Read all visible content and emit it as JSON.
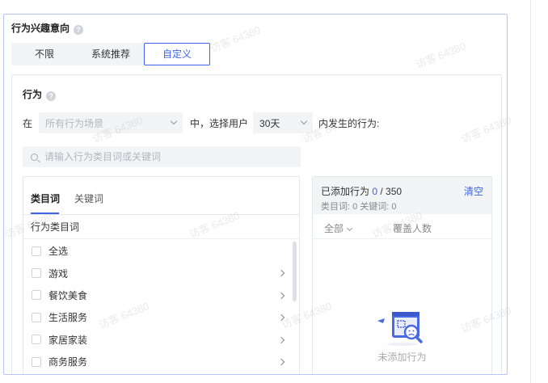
{
  "section": {
    "title": "行为兴趣意向"
  },
  "segment": {
    "options": [
      "不限",
      "系统推荐",
      "自定义"
    ],
    "selected": "自定义"
  },
  "behavior": {
    "title": "行为",
    "prefix_in": "在",
    "scene_placeholder": "所有行为场景",
    "mid_text": "中，选择用户",
    "days_value": "30天",
    "suffix_text": "内发生的行为:",
    "search_placeholder": "请输入行为类目词或关键词"
  },
  "left_panel": {
    "tabs": [
      "类目词",
      "关键词"
    ],
    "active_tab": "类目词",
    "list_header": "行为类目词",
    "items": [
      {
        "label": "全选",
        "has_children": false
      },
      {
        "label": "游戏",
        "has_children": true
      },
      {
        "label": "餐饮美食",
        "has_children": true
      },
      {
        "label": "生活服务",
        "has_children": true
      },
      {
        "label": "家居家装",
        "has_children": true
      },
      {
        "label": "商务服务",
        "has_children": true
      }
    ]
  },
  "right_panel": {
    "added_label": "已添加行为",
    "added_count": "0",
    "added_sep": " / 350",
    "clear_label": "清空",
    "counts_text": "类目词: 0   关键词: 0",
    "col_all": "全部",
    "col_cover": "覆盖人数",
    "empty_text": "未添加行为"
  },
  "watermark_text": "访客 64380",
  "colors": {
    "accent": "#3d63e6",
    "border": "#b8c6f5"
  }
}
